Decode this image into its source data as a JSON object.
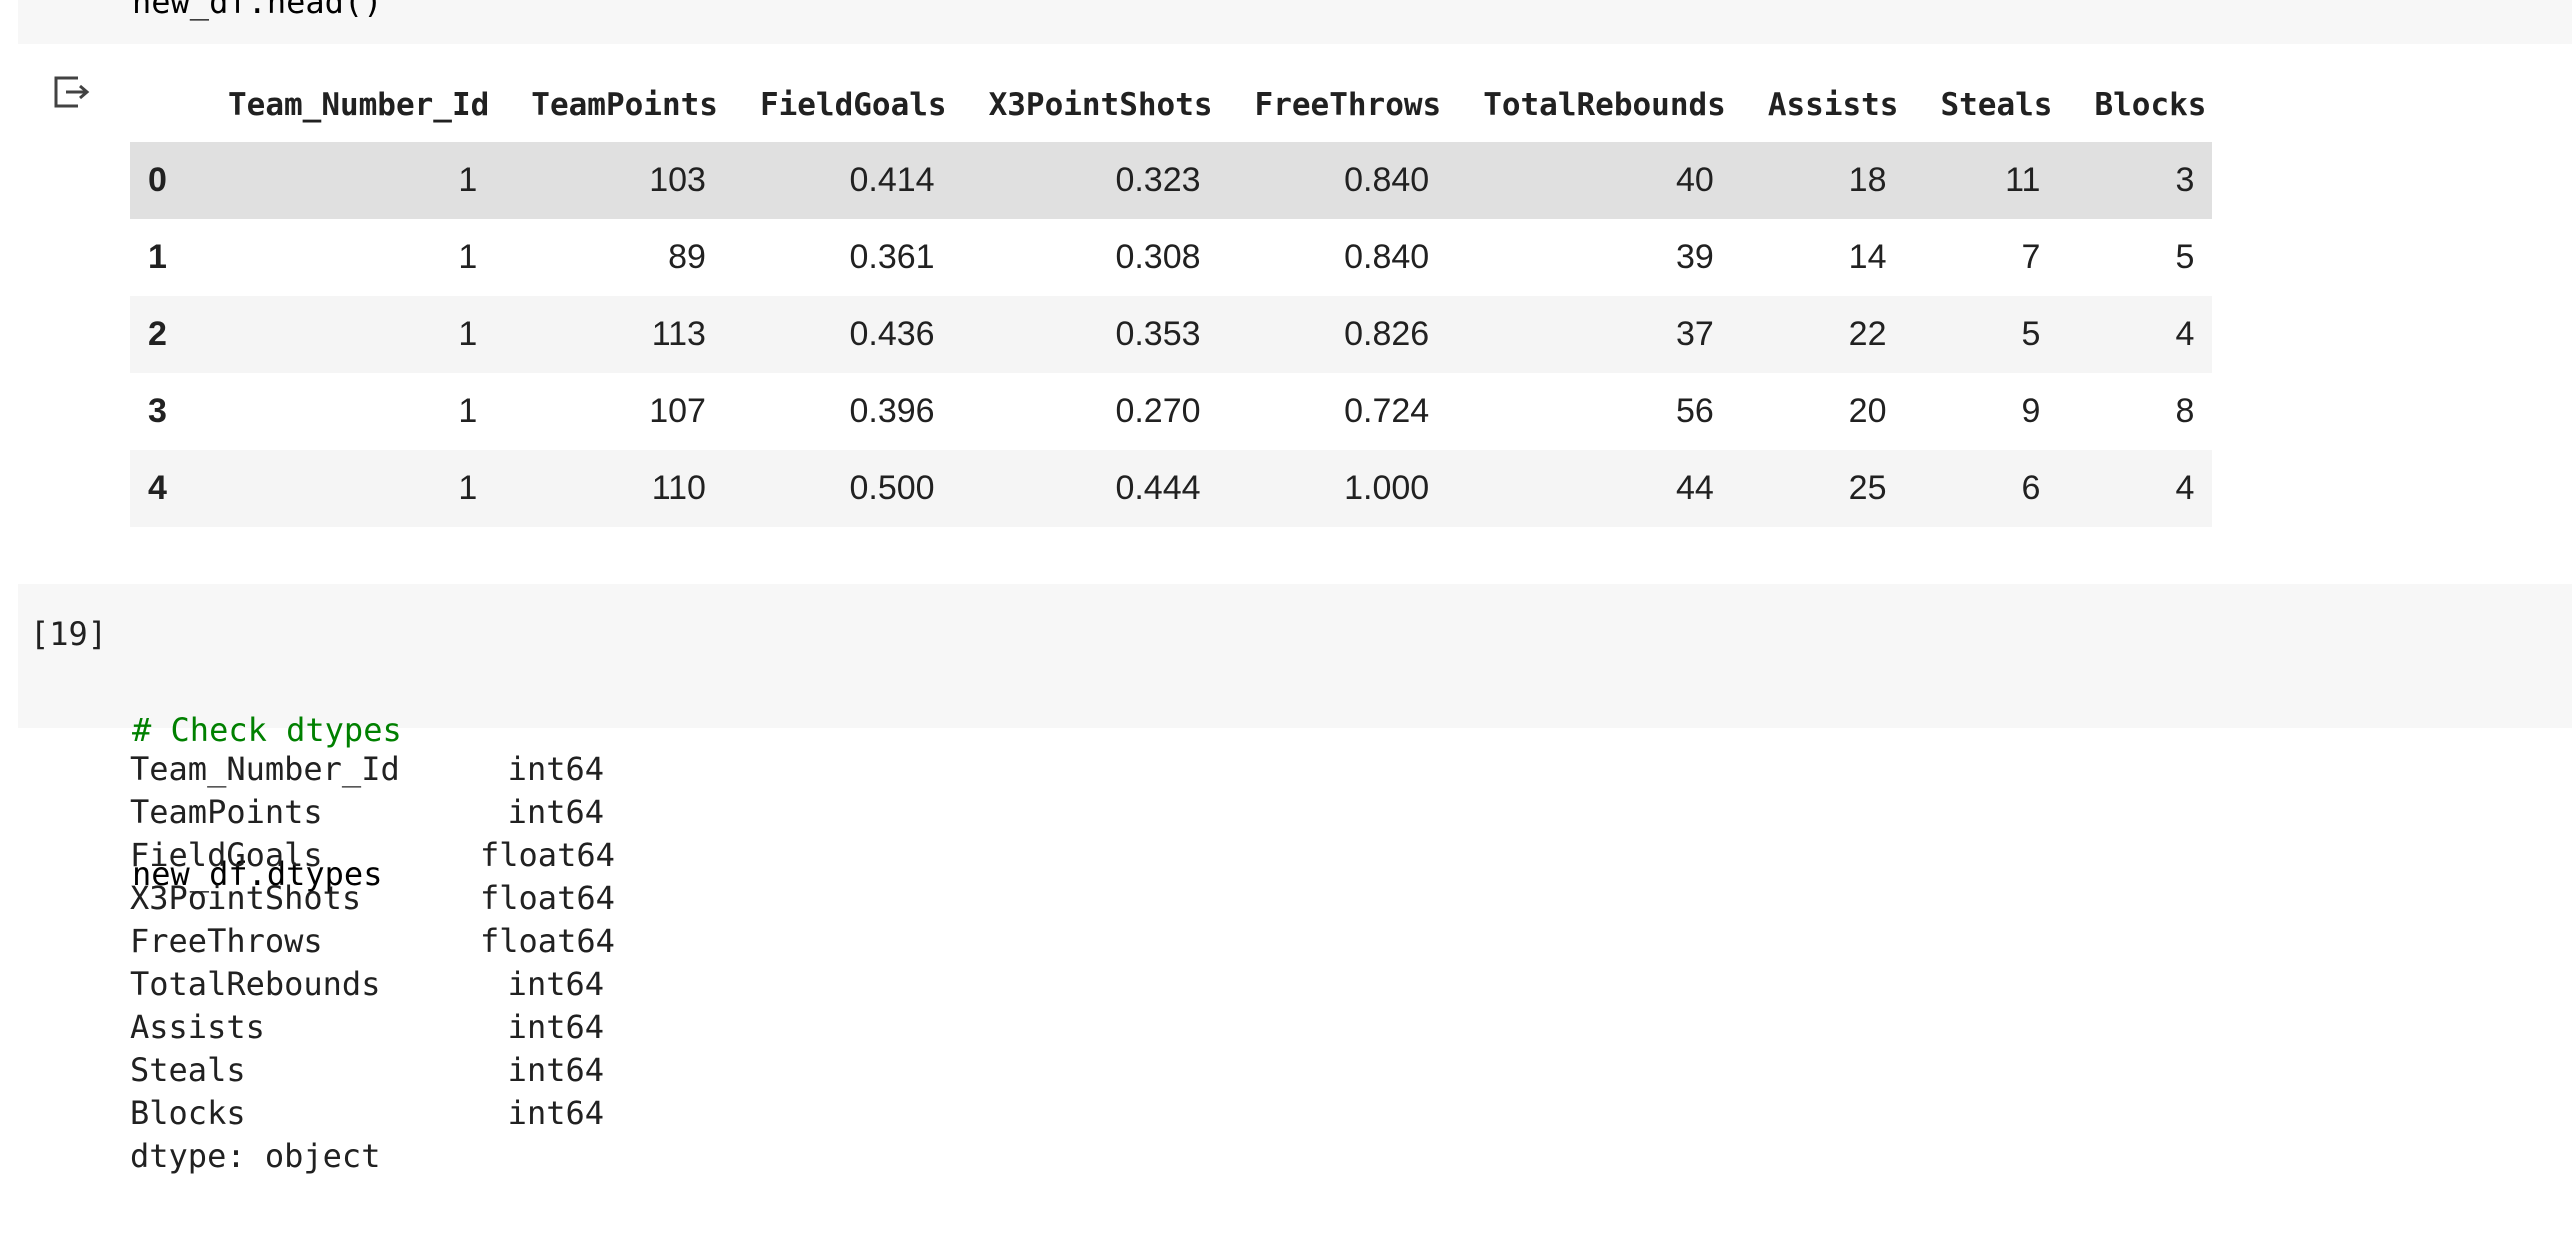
{
  "previous_cell": {
    "code": "new_df.head()"
  },
  "output_icon": "output-redirect-icon",
  "dataframe": {
    "columns": [
      "Team_Number_Id",
      "TeamPoints",
      "FieldGoals",
      "X3PointShots",
      "FreeThrows",
      "TotalRebounds",
      "Assists",
      "Steals",
      "Blocks"
    ],
    "rows": [
      {
        "index": "0",
        "values": [
          "1",
          "103",
          "0.414",
          "0.323",
          "0.840",
          "40",
          "18",
          "11",
          "3"
        ]
      },
      {
        "index": "1",
        "values": [
          "1",
          "89",
          "0.361",
          "0.308",
          "0.840",
          "39",
          "14",
          "7",
          "5"
        ]
      },
      {
        "index": "2",
        "values": [
          "1",
          "113",
          "0.436",
          "0.353",
          "0.826",
          "37",
          "22",
          "5",
          "4"
        ]
      },
      {
        "index": "3",
        "values": [
          "1",
          "107",
          "0.396",
          "0.270",
          "0.724",
          "56",
          "20",
          "9",
          "8"
        ]
      },
      {
        "index": "4",
        "values": [
          "1",
          "110",
          "0.500",
          "0.444",
          "1.000",
          "44",
          "25",
          "6",
          "4"
        ]
      }
    ]
  },
  "cell_19": {
    "prompt": "[19]",
    "comment": "# Check dtypes",
    "code": "new_df.dtypes"
  },
  "dtypes_output": {
    "rows": [
      {
        "name": "Team_Number_Id",
        "type": "int64"
      },
      {
        "name": "TeamPoints",
        "type": "int64"
      },
      {
        "name": "FieldGoals",
        "type": "float64"
      },
      {
        "name": "X3PointShots",
        "type": "float64"
      },
      {
        "name": "FreeThrows",
        "type": "float64"
      },
      {
        "name": "TotalRebounds",
        "type": "int64"
      },
      {
        "name": "Assists",
        "type": "int64"
      },
      {
        "name": "Steals",
        "type": "int64"
      },
      {
        "name": "Blocks",
        "type": "int64"
      }
    ],
    "footer": "dtype: object"
  },
  "colors": {
    "cell_bg": "#f7f7f7",
    "row_stripe": "#f5f5f5",
    "row_hover": "#e0e0e0",
    "comment": "#008000"
  }
}
